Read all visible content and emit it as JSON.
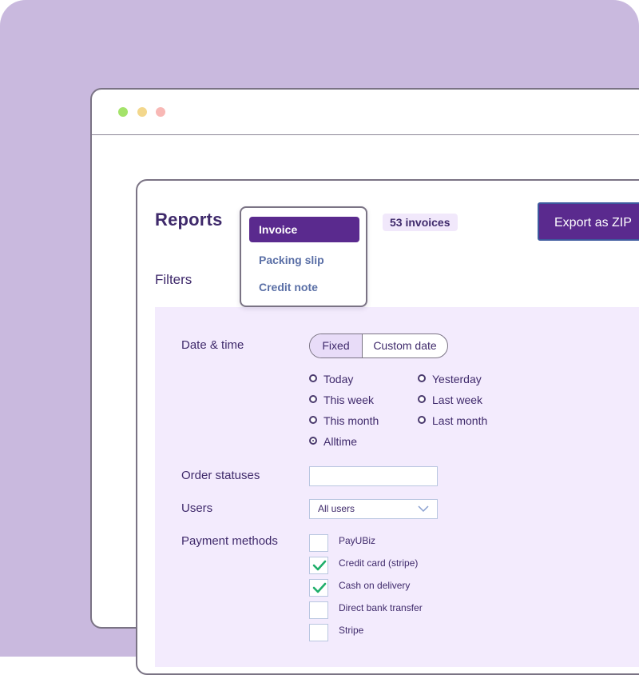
{
  "reports": {
    "title": "Reports",
    "filters_label": "Filters",
    "badge": "53 invoices",
    "export_label": "Export as ZIP",
    "document_types": [
      "Invoice",
      "Packing slip",
      "Credit note"
    ],
    "selected_document_type": "Invoice"
  },
  "filters": {
    "date_time_label": "Date & time",
    "date_mode_tabs": [
      "Fixed",
      "Custom date"
    ],
    "date_mode_selected": "Fixed",
    "date_options": {
      "today": "Today",
      "yesterday": "Yesterday",
      "this_week": "This week",
      "last_week": "Last week",
      "this_month": "This month",
      "last_month": "Last month",
      "alltime": "Alltime"
    },
    "date_selected": "Alltime",
    "order_statuses_label": "Order statuses",
    "order_statuses_value": "",
    "users_label": "Users",
    "users_value": "All users",
    "payment_methods_label": "Payment methods",
    "payment_methods": [
      {
        "label": "PayUBiz",
        "checked": false
      },
      {
        "label": "Credit card (stripe)",
        "checked": true
      },
      {
        "label": "Cash on delivery",
        "checked": true
      },
      {
        "label": "Direct bank transfer",
        "checked": false
      },
      {
        "label": "Stripe",
        "checked": false
      }
    ]
  },
  "colors": {
    "accent": "#5a2a8e",
    "background": "#c9b9de",
    "filter_area": "#f3ebfd",
    "check": "#1fae6a"
  },
  "icons": {
    "window_controls": [
      "green-dot-icon",
      "yellow-dot-icon",
      "red-dot-icon"
    ],
    "select_chevron": "chevron-down-icon",
    "check": "checkmark-icon"
  }
}
